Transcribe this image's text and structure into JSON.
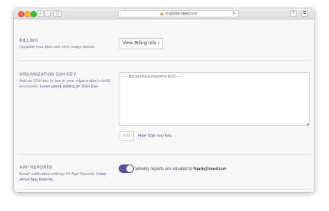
{
  "browser": {
    "url": "console.seed.run",
    "lock_glyph": "🔒",
    "reload_glyph": "↻",
    "back_glyph": "‹",
    "forward_glyph": "›",
    "sidebar_glyph": "▯",
    "share_glyph": "⇧",
    "tabs_glyph": "⧉"
  },
  "billing": {
    "title": "BILLING",
    "description": "Upgrade your plan and view usage details.",
    "button_label": "View Billing Info ›"
  },
  "ssh_key": {
    "title": "ORGANIZATION SSH KEY",
    "description_prefix": "Add an SSH key to use in your organization's build processes.",
    "description_link": "Learn about adding an SSH Key.",
    "textarea_placeholder": "-----BEGIN RSA PRIVATE KEY-----",
    "add_button_label": "Add",
    "hide_link_label": "Hide SSH Key Info"
  },
  "app_reports": {
    "title": "APP REPORTS",
    "description_prefix": "Email notification settings for App Reports.",
    "description_link": "Learn about App Reports.",
    "toggle_on": true,
    "weekly_text": "Weekly reports are emailed to",
    "email": "frank@seed.run"
  },
  "colors": {
    "accent": "#5b4a9d",
    "background": "#f7f7f9"
  }
}
